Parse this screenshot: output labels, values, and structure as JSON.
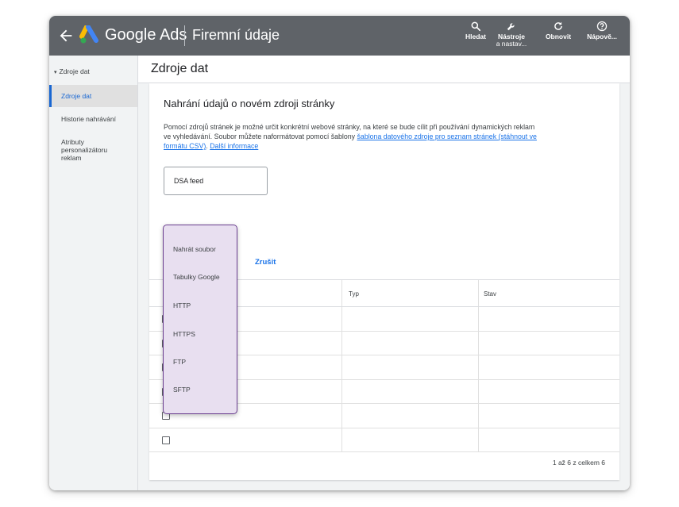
{
  "app": {
    "brand_google": "Google",
    "brand_ads": "Ads",
    "page_title": "Firemní údaje"
  },
  "toolbar": {
    "search_label": "Hledat",
    "tools_label_1": "Nástroje",
    "tools_label_2": "a nastav...",
    "refresh_label": "Obnovit",
    "help_label": "Nápově..."
  },
  "sidebar": {
    "group": "Zdroje dat",
    "items": [
      {
        "label": "Zdroje dat",
        "active": true
      },
      {
        "label": "Historie nahrávání",
        "active": false
      },
      {
        "label_lines": [
          "Atributy",
          "personalizátoru",
          "reklam"
        ],
        "active": false
      }
    ]
  },
  "main": {
    "title": "Zdroje dat",
    "card_title": "Nahrání údajů o novém zdroji stránky",
    "desc_text": "Pomocí zdrojů stránek je možné určit konkrétní webové stránky, na které se bude cílit při používání dynamických reklam ve vyhledávání. Soubor můžete naformátovat pomocí šablony",
    "desc_link": "šablona datového zdroje pro seznam stránek (stáhnout ve formátu CSV)",
    "desc_sep": ". ",
    "desc_more": "Další informace",
    "name_value": "DSA feed",
    "cancel_label": "Zrušit"
  },
  "dropdown": {
    "options": [
      "Nahrát soubor",
      "Tabulky Google",
      "HTTP",
      "HTTPS",
      "FTP",
      "SFTP"
    ]
  },
  "table": {
    "columns": [
      "",
      "Typ",
      "Stav"
    ],
    "row_count": 6,
    "pager": "1 až 6 z celkem 6"
  },
  "colors": {
    "topbar": "#5f6368",
    "accent": "#1a73e8",
    "dropdown_bg": "#e8dff0",
    "dropdown_border": "#6a3e8f"
  }
}
